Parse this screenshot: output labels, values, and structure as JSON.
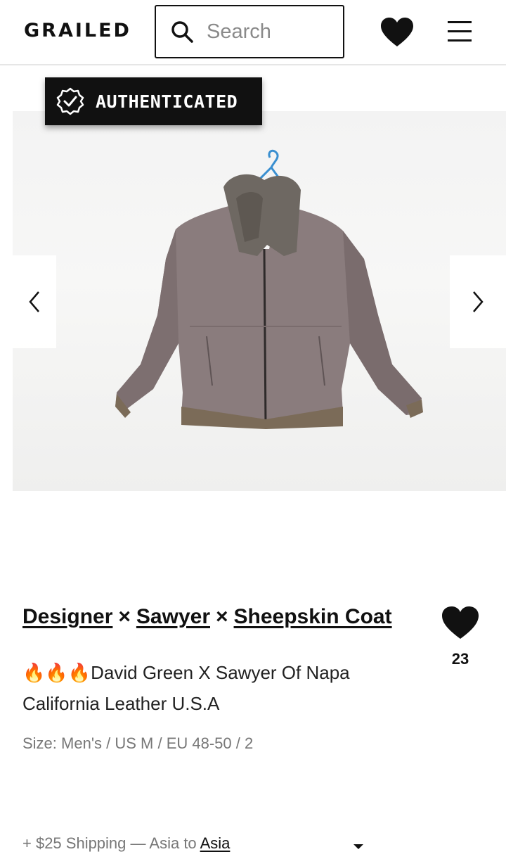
{
  "header": {
    "logo": "GRAILED",
    "search_placeholder": "Search"
  },
  "badge": {
    "label": "AUTHENTICATED"
  },
  "listing": {
    "designers": [
      "Designer",
      "Sawyer",
      "Sheepskin Coat"
    ],
    "separator": "×",
    "title": "🔥🔥🔥David Green X Sawyer Of Napa California Leather U.S.A",
    "size": "Size: Men's / US M / EU 48-50 / 2",
    "favorites": "23"
  },
  "shipping": {
    "text": "+ $25 Shipping — Asia to",
    "country": "Asia"
  },
  "icons": {
    "search": "search-icon",
    "heart": "heart-icon",
    "menu": "hamburger-menu-icon",
    "verified": "verified-check-icon",
    "prev": "chevron-left-icon",
    "next": "chevron-right-icon",
    "dropdown": "caret-down-icon"
  }
}
